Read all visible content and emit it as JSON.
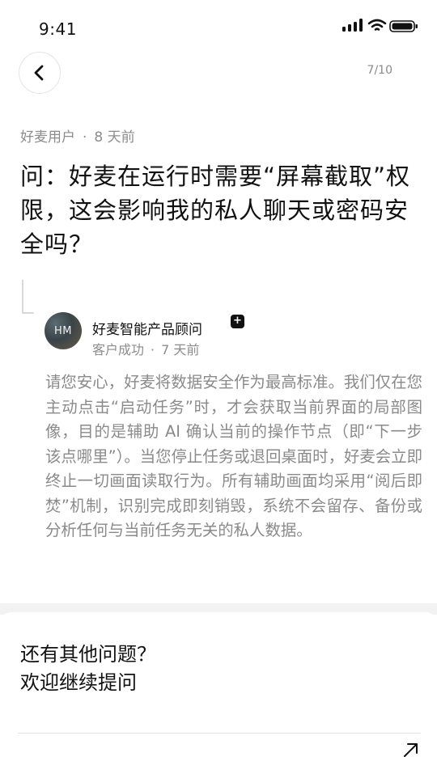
{
  "status_bar": {
    "time": "9:41"
  },
  "header": {
    "page_indicator": "7/10"
  },
  "question": {
    "author": "好麦用户",
    "separator": "·",
    "time_ago": "8 天前",
    "title": "问：好麦在运行时需要“屏幕截取”权限，这会影响我的私人聊天或密码安全吗？"
  },
  "answer": {
    "avatar_initials": "HM",
    "name": "好麦智能产品顾问",
    "badge": "+",
    "role": "客户成功",
    "separator": "·",
    "time_ago": "7 天前",
    "body": "请您安心，好麦将数据安全作为最高标准。我们仅在您主动点击“启动任务”时，才会获取当前界面的局部图像，目的是辅助 AI 确认当前的操作节点（即“下一步该点哪里”）。当您停止任务或退回桌面时，好麦会立即终止一切画面读取行为。所有辅助画面均采用“阅后即焚”机制，识别完成即刻销毁，系统不会留存、备份或分析任何与当前任务无关的私人数据。"
  },
  "footer": {
    "line1": "还有其他问题？",
    "line2": "欢迎继续提问"
  },
  "icons": {
    "back": "chevron-left-icon",
    "arrow": "arrow-up-right-icon"
  }
}
